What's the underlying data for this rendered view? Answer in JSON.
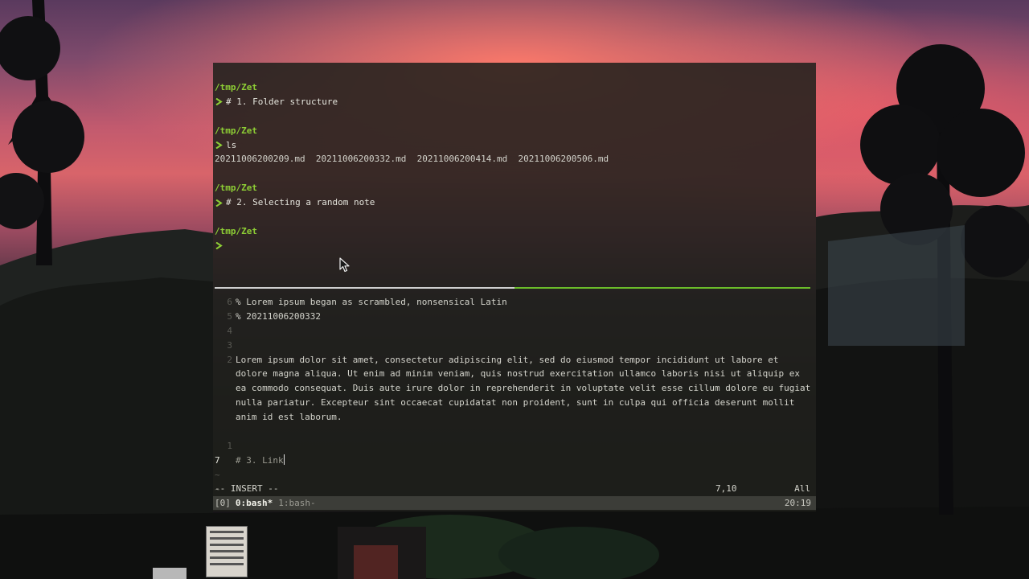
{
  "shell": {
    "blocks": [
      {
        "path": "/tmp/Zet",
        "command": "# 1. Folder structure"
      },
      {
        "path": "/tmp/Zet",
        "command": "ls",
        "output": "20211006200209.md  20211006200332.md  20211006200414.md  20211006200506.md"
      },
      {
        "path": "/tmp/Zet",
        "command": "# 2. Selecting a random note"
      },
      {
        "path": "/tmp/Zet",
        "command": ""
      }
    ]
  },
  "vim": {
    "lines": [
      {
        "num": "6",
        "text": "% Lorem ipsum began as scrambled, nonsensical Latin"
      },
      {
        "num": "5",
        "text": "% 20211006200332"
      },
      {
        "num": "4",
        "text": ""
      },
      {
        "num": "3",
        "text": ""
      },
      {
        "num": "2",
        "text": "Lorem ipsum dolor sit amet, consectetur adipiscing elit, sed do eiusmod tempor incididunt ut labore et"
      },
      {
        "num": "",
        "text": "dolore magna aliqua. Ut enim ad minim veniam, quis nostrud exercitation ullamco laboris nisi ut aliquip ex"
      },
      {
        "num": "",
        "text": "ea commodo consequat. Duis aute irure dolor in reprehenderit in voluptate velit esse cillum dolore eu fugiat"
      },
      {
        "num": "",
        "text": "nulla pariatur. Excepteur sint occaecat cupidatat non proident, sunt in culpa qui officia deserunt mollit"
      },
      {
        "num": "",
        "text": "anim id est laborum."
      },
      {
        "num": "",
        "text": ""
      },
      {
        "num": "1",
        "text": ""
      }
    ],
    "current_line": {
      "num": "7",
      "text": "# 3. Link"
    },
    "tildes": [
      "~",
      "~"
    ],
    "mode": "-- INSERT --",
    "position": "7,10",
    "scroll": "All"
  },
  "tmux": {
    "session": "[0]",
    "active_window": "0:bash*",
    "inactive_window": "1:bash-",
    "clock": "20:19"
  },
  "colors": {
    "path": "#8ecf35",
    "divider_active": "#6bbd2a",
    "terminal_bg": "#1e1f1b",
    "status_bg": "#3c3d38"
  },
  "icons": {
    "prompt": "chevron-right-icon",
    "pointer": "mouse-cursor-icon"
  }
}
